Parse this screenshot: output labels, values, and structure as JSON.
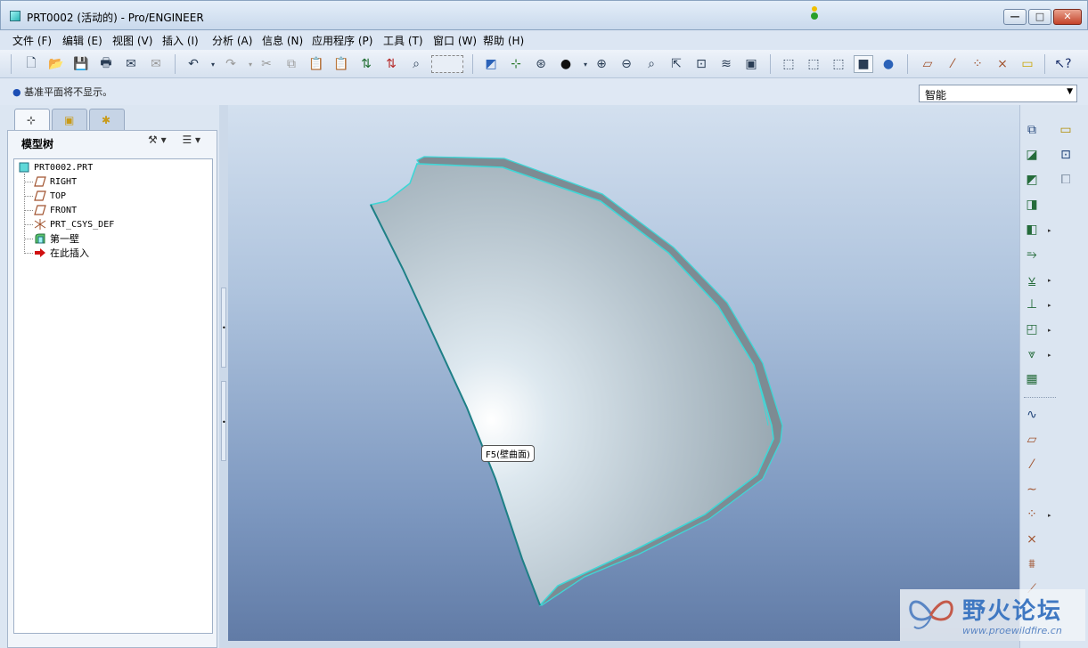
{
  "window": {
    "title": "PRT0002 (活动的) - Pro/ENGINEER",
    "minimize": "—",
    "maximize": "□",
    "close": "✕"
  },
  "menu": [
    "文件 (F)",
    "编辑 (E)",
    "视图 (V)",
    "插入 (I)",
    "分析 (A)",
    "信息 (N)",
    "应用程序 (P)",
    "工具 (T)",
    "窗口 (W)",
    "帮助 (H)"
  ],
  "status": {
    "message": "基准平面将不显示。",
    "filter_value": "智能"
  },
  "navigator": {
    "title": "模型树",
    "tree": [
      {
        "label": "PRT0002.PRT",
        "icon": "part-icon"
      },
      {
        "label": "RIGHT",
        "icon": "datum-plane-icon"
      },
      {
        "label": "TOP",
        "icon": "datum-plane-icon"
      },
      {
        "label": "FRONT",
        "icon": "datum-plane-icon"
      },
      {
        "label": "PRT_CSYS_DEF",
        "icon": "coordinate-system-icon"
      },
      {
        "label": "第一壁",
        "icon": "sheetmetal-wall-icon"
      },
      {
        "label": "在此插入",
        "icon": "insert-here-arrow-icon"
      }
    ]
  },
  "viewport": {
    "tooltip": "F5(壁曲面)",
    "model_edge_color": "#3fd6d6"
  },
  "watermark": {
    "name": "野火论坛",
    "url": "www.proewildfire.cn"
  },
  "colors": {
    "accent": "#3f78c2",
    "edge_highlight": "#3fd6d6",
    "insert_arrow": "#d01010"
  }
}
